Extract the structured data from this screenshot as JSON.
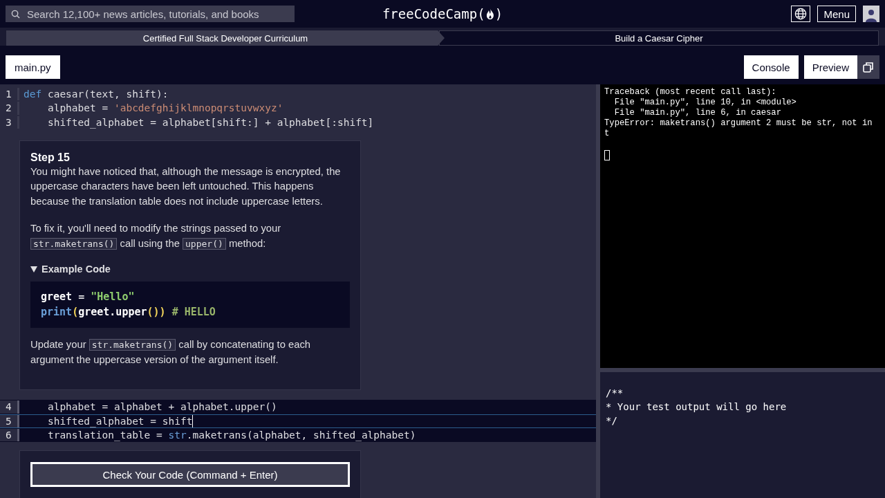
{
  "header": {
    "search": {
      "placeholder": "Search 12,100+ news articles, tutorials, and books"
    },
    "brand": {
      "name": "freeCodeCamp",
      "paren_open": "(",
      "paren_close": ")"
    },
    "menu_button": "Menu"
  },
  "breadcrumb": [
    "Certified Full Stack Developer Curriculum",
    "Build a Caesar Cipher"
  ],
  "file_tab": "main.py",
  "panel_buttons": [
    "Console",
    "Preview"
  ],
  "editor": {
    "lines_before": [
      {
        "number": "1",
        "active": false,
        "tokens": [
          {
            "kind": "keyword",
            "text": "def"
          },
          {
            "kind": "plain",
            "text": " caesar(text, shift):"
          }
        ]
      },
      {
        "number": "2",
        "active": false,
        "tokens": [
          {
            "kind": "plain",
            "text": "    alphabet = "
          },
          {
            "kind": "string",
            "text": "'abcdefghijklmnopqrstuvwxyz'"
          }
        ]
      },
      {
        "number": "3",
        "active": false,
        "tokens": [
          {
            "kind": "plain",
            "text": "    shifted_alphabet = alphabet[shift:] + alphabet[:shift]"
          }
        ]
      }
    ],
    "lines_after": [
      {
        "number": "4",
        "active": false,
        "tokens": [
          {
            "kind": "plain",
            "text": "    alphabet = alphabet + alphabet.upper()"
          }
        ]
      },
      {
        "number": "5",
        "active": true,
        "tokens": [
          {
            "kind": "plain",
            "text": "    shifted_alphabet = shift"
          }
        ]
      },
      {
        "number": "6",
        "active": false,
        "tokens": [
          {
            "kind": "plain",
            "text": "    translation_table = "
          },
          {
            "kind": "builtin",
            "text": "str"
          },
          {
            "kind": "plain",
            "text": ".maketrans(alphabet, shifted_alphabet)"
          }
        ]
      }
    ]
  },
  "step": {
    "title": "Step 15",
    "paragraphs_before": [
      [
        {
          "kind": "text",
          "text": "You might have noticed that, although the message is encrypted, the uppercase characters have been left untouched. This happens because the translation table does not include uppercase letters."
        }
      ],
      [
        {
          "kind": "text",
          "text": "To fix it, you'll need to modify the strings passed to your "
        },
        {
          "kind": "code",
          "text": "str.maketrans()"
        },
        {
          "kind": "text",
          "text": " call using the "
        },
        {
          "kind": "code",
          "text": "upper()"
        },
        {
          "kind": "text",
          "text": " method:"
        }
      ]
    ],
    "example": {
      "summary": "Example Code",
      "expanded": true,
      "lines": [
        [
          {
            "kind": "name",
            "text": "greet"
          },
          {
            "kind": "plain",
            "text": " = "
          },
          {
            "kind": "greenstring",
            "text": "\"Hello\""
          }
        ],
        [
          {
            "kind": "builtin",
            "text": "print"
          },
          {
            "kind": "paren",
            "text": "("
          },
          {
            "kind": "name",
            "text": "greet.upper"
          },
          {
            "kind": "paren",
            "text": "())"
          },
          {
            "kind": "comment",
            "text": " # HELLO"
          }
        ]
      ]
    },
    "paragraphs_after": [
      [
        {
          "kind": "text",
          "text": "Update your "
        },
        {
          "kind": "code",
          "text": "str.maketrans()"
        },
        {
          "kind": "text",
          "text": " call by concatenating to each argument the uppercase version of the argument itself."
        }
      ]
    ]
  },
  "check_button": "Check Your Code (Command + Enter)",
  "console": {
    "lines": [
      "Traceback (most recent call last):",
      "  File \"main.py\", line 10, in <module>",
      "  File \"main.py\", line 6, in caesar",
      "TypeError: maketrans() argument 2 must be str, not in",
      "t"
    ]
  },
  "test_output": {
    "lines": [
      "/**",
      "* Your test output will go here",
      "*/"
    ]
  }
}
